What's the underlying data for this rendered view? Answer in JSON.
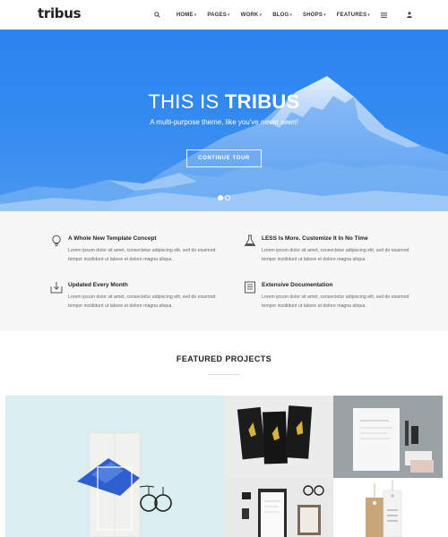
{
  "nav": {
    "logo": "tribus",
    "items": [
      {
        "label": "HOME"
      },
      {
        "label": "PAGES"
      },
      {
        "label": "WORK"
      },
      {
        "label": "BLOG"
      },
      {
        "label": "SHOPS"
      },
      {
        "label": "FEATURES"
      }
    ]
  },
  "hero": {
    "title_light": "THIS IS ",
    "title_bold": "TRIBUS",
    "subtitle": "A multi-purpose theme, like you've never seen!",
    "button": "CONTINUE TOUR",
    "slide_count": 2,
    "active_slide": 1
  },
  "features": [
    {
      "title": "A Whole New Template Concept",
      "text": "Lorem ipsum dolor sit amet, consectetur adipiscing elit, sed do eiusmod tempor incididunt ut labore et dolore magna aliqua.",
      "icon": "lightbulb-icon"
    },
    {
      "title": "LESS Is More. Customize It In No Time",
      "text": "Lorem ipsum dolor sit amet, consectetur adipiscing elit, sed do eiusmod tempor incididunt ut labore et dolore magna aliqua.",
      "icon": "flask-icon"
    },
    {
      "title": "Updated Every Month",
      "text": "Lorem ipsum dolor sit amet, consectetur adipiscing elit, sed do eiusmod tempor incididunt ut labore et dolore magna aliqua.",
      "icon": "download-icon"
    },
    {
      "title": "Extensive Documentation",
      "text": "Lorem ipsum dolor sit amet, consectetur adipiscing elit, sed do eiusmod tempor incididunt ut labore et dolore magna aliqua.",
      "icon": "document-icon"
    }
  ],
  "projects": {
    "title": "FEATURED PROJECTS"
  },
  "colors": {
    "accent": "#2b8bf2",
    "hero": "#3289f0",
    "features_bg": "#f7f7f7"
  }
}
